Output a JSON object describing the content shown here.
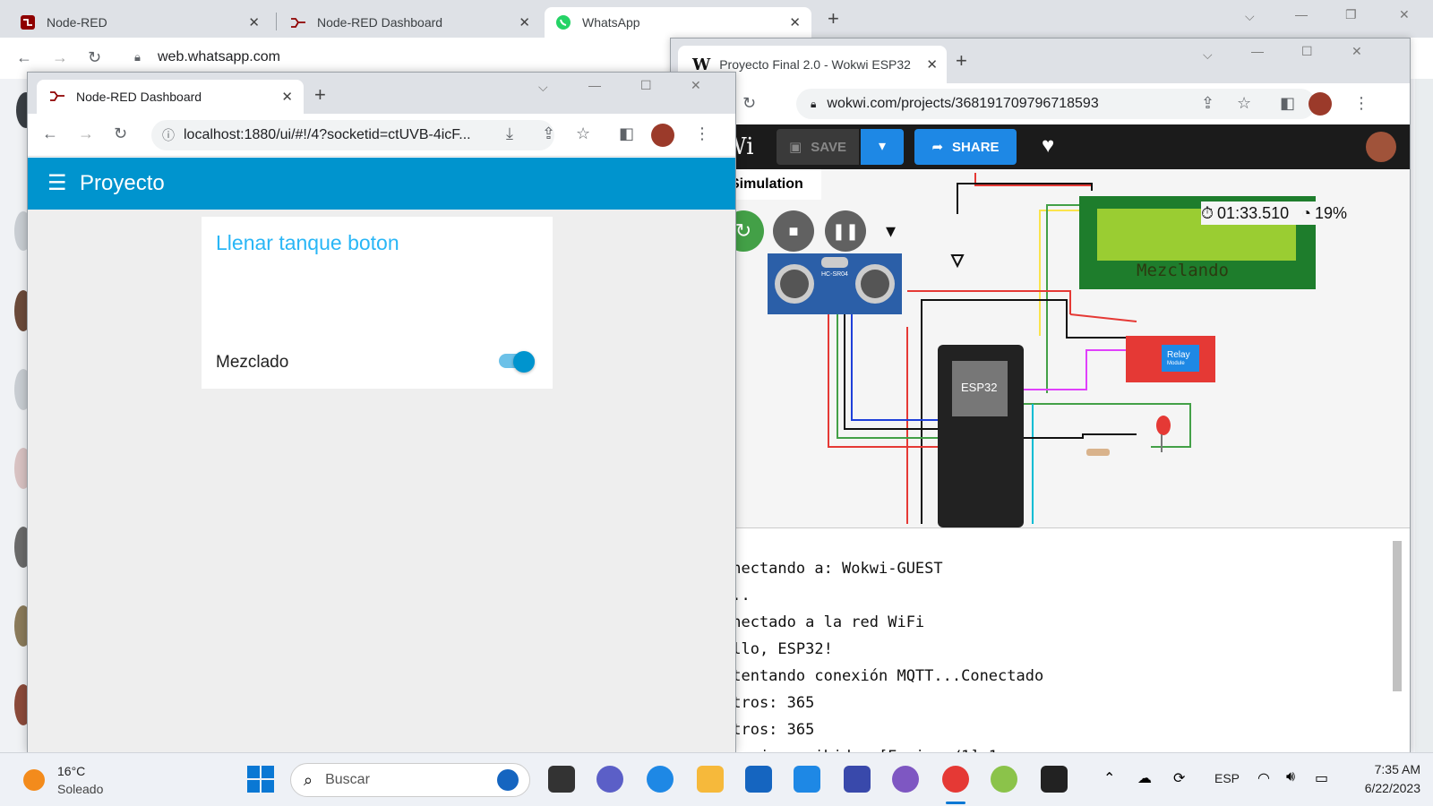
{
  "back_browser": {
    "tabs": [
      {
        "label": "Node-RED"
      },
      {
        "label": "Node-RED Dashboard"
      },
      {
        "label": "WhatsApp"
      }
    ],
    "url": "web.whatsapp.com"
  },
  "node_red_window": {
    "tab_label": "Node-RED Dashboard",
    "url": "localhost:1880/ui/#!/4?socketid=ctUVB-4icF...",
    "header_title": "Proyecto",
    "card_title": "Llenar tanque boton",
    "switch_label": "Mezclado",
    "switch_on": true,
    "colors": {
      "header": "#0094ce",
      "title": "#29b6f6",
      "switch": "#0094ce"
    }
  },
  "wokwi_window": {
    "tab_label": "Proyecto Final 2.0 - Wokwi ESP32",
    "url": "wokwi.com/projects/368191709796718593",
    "logo_text": "Wi",
    "save_label": "SAVE",
    "share_label": "SHARE",
    "simulation_tab": "Simulation",
    "timer": "01:33.510",
    "speed": "19%",
    "lcd_text": "Mezclando",
    "esp_label": "ESP32",
    "relay_label": "Relay",
    "relay_sub": "Module",
    "sensor_label": "HC-SR04",
    "console_lines": [
      "onectando a: Wokwi-GUEST",
      "...",
      "onectado a la red WiFi",
      "ello, ESP32!",
      "ntentando conexión MQTT...Conectado",
      "itros: 365",
      "itros: 365",
      "ensaje recibido: [Equipo-/1] 1"
    ]
  },
  "taskbar": {
    "weather_temp": "16°C",
    "weather_desc": "Soleado",
    "search_placeholder": "Buscar",
    "language": "ESP",
    "time": "7:35 AM",
    "date": "6/22/2023"
  }
}
